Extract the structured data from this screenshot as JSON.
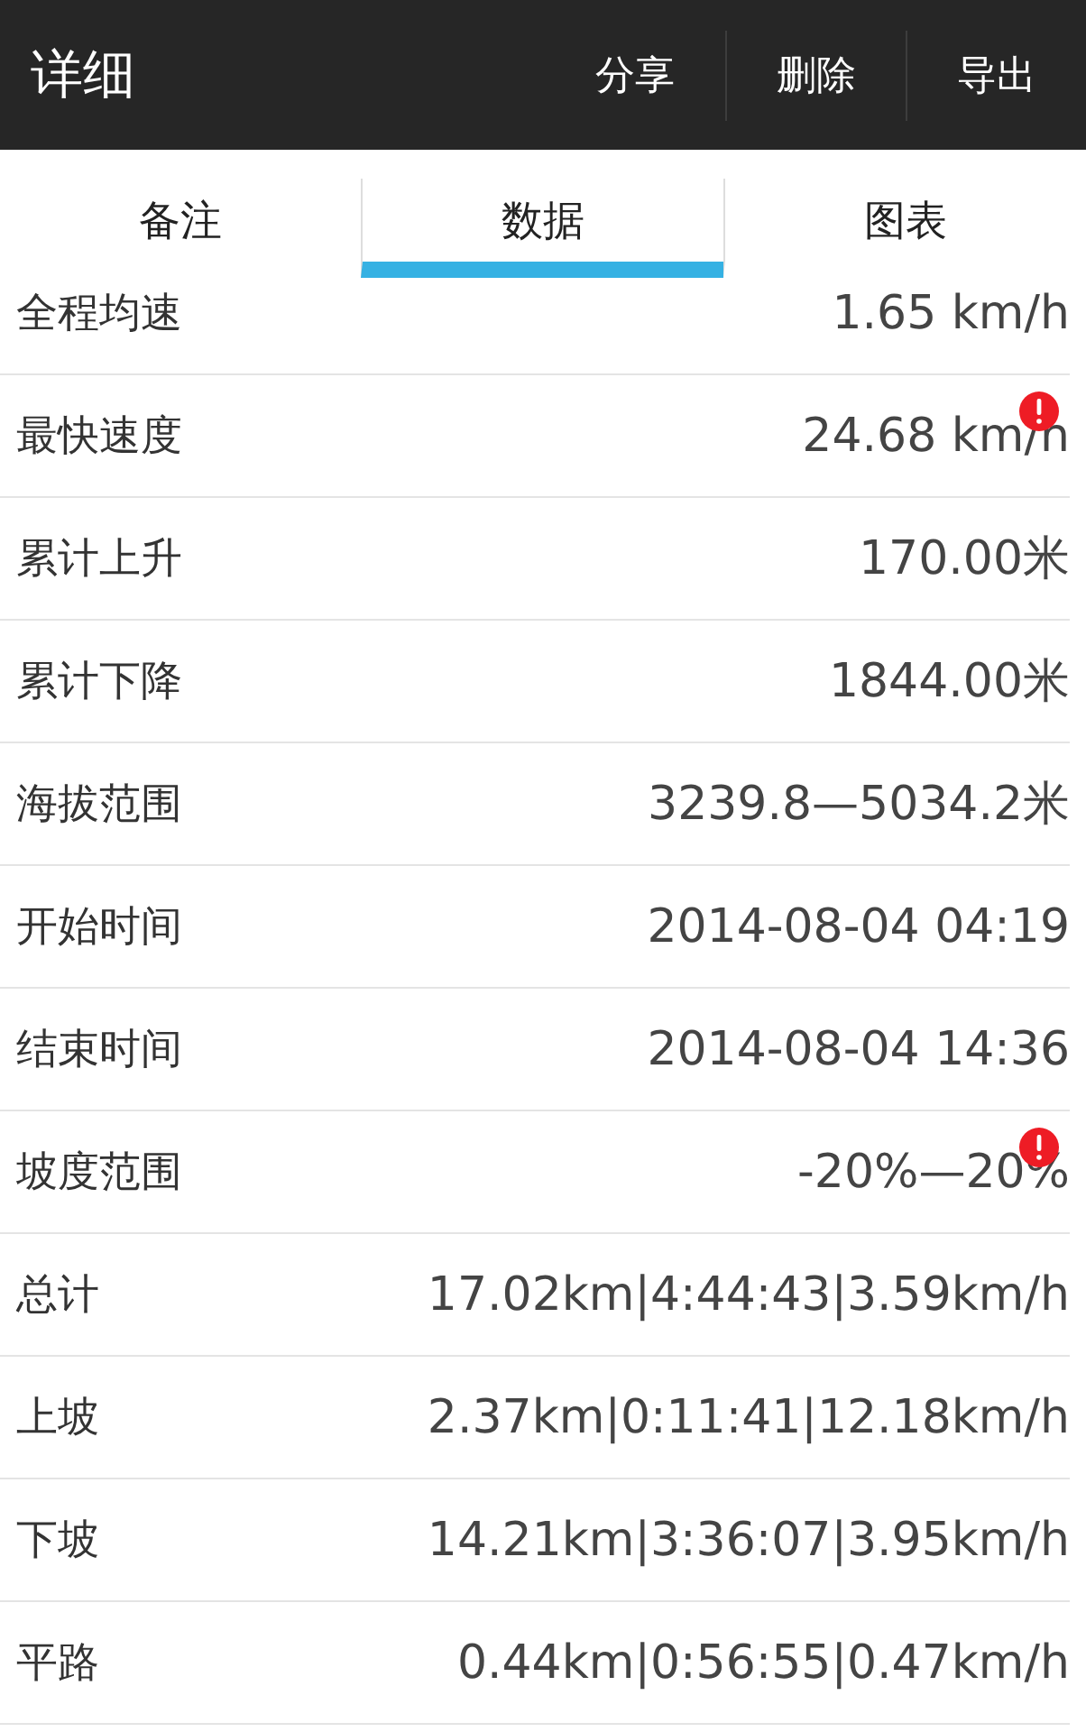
{
  "header": {
    "title": "详细",
    "actions": [
      "分享",
      "删除",
      "导出"
    ]
  },
  "tabs": [
    {
      "label": "备注",
      "selected": false
    },
    {
      "label": "数据",
      "selected": true
    },
    {
      "label": "图表",
      "selected": false
    }
  ],
  "rows": [
    {
      "label": "全程均速",
      "value": "1.65 km/h",
      "warning": false
    },
    {
      "label": "最快速度",
      "value": "24.68 km/h",
      "warning": true
    },
    {
      "label": "累计上升",
      "value": "170.00米",
      "warning": false
    },
    {
      "label": "累计下降",
      "value": "1844.00米",
      "warning": false
    },
    {
      "label": "海拔范围",
      "value": "3239.8—5034.2米",
      "warning": false
    },
    {
      "label": "开始时间",
      "value": "2014-08-04 04:19",
      "warning": false
    },
    {
      "label": "结束时间",
      "value": "2014-08-04 14:36",
      "warning": false
    },
    {
      "label": "坡度范围",
      "value": "-20%—20%",
      "warning": true
    },
    {
      "label": "总计",
      "value": "17.02km|4:44:43|3.59km/h",
      "warning": false
    },
    {
      "label": "上坡",
      "value": "2.37km|0:11:41|12.18km/h",
      "warning": false
    },
    {
      "label": "下坡",
      "value": "14.21km|3:36:07|3.95km/h",
      "warning": false
    },
    {
      "label": "平路",
      "value": "0.44km|0:56:55|0.47km/h",
      "warning": false
    }
  ]
}
